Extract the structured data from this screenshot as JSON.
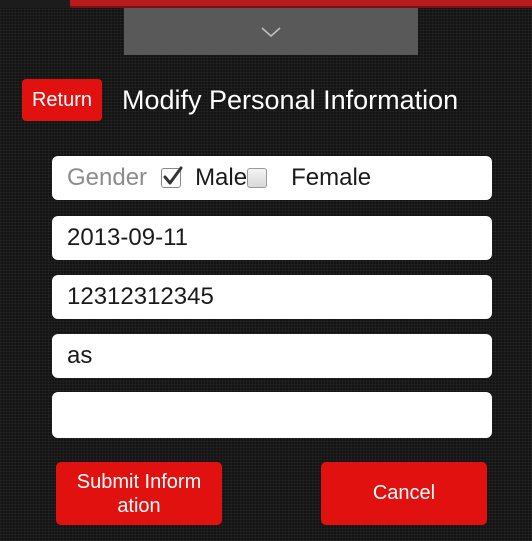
{
  "header": {
    "return_label": "Return",
    "title": "Modify Personal Information"
  },
  "form": {
    "gender_label": "Gender",
    "gender_options": [
      {
        "label": "Male",
        "checked": true
      },
      {
        "label": "Female",
        "checked": false
      }
    ],
    "birthday_value": "2013-09-11",
    "phone_value": "12312312345",
    "name_value": "as",
    "partial_field_value": ""
  },
  "actions": {
    "submit_label": "Submit Inform ation",
    "cancel_label": "Cancel"
  },
  "colors": {
    "accent_red": "#e0110f",
    "background": "#141414",
    "pulldown_tab": "#595959",
    "field_bg": "#ffffff",
    "placeholder_gray": "#8c8c8c"
  },
  "icons": {
    "pulldown": "chevron-down-icon",
    "male_checkbox": "checkbox-checked-icon",
    "female_checkbox": "checkbox-unchecked-icon"
  }
}
